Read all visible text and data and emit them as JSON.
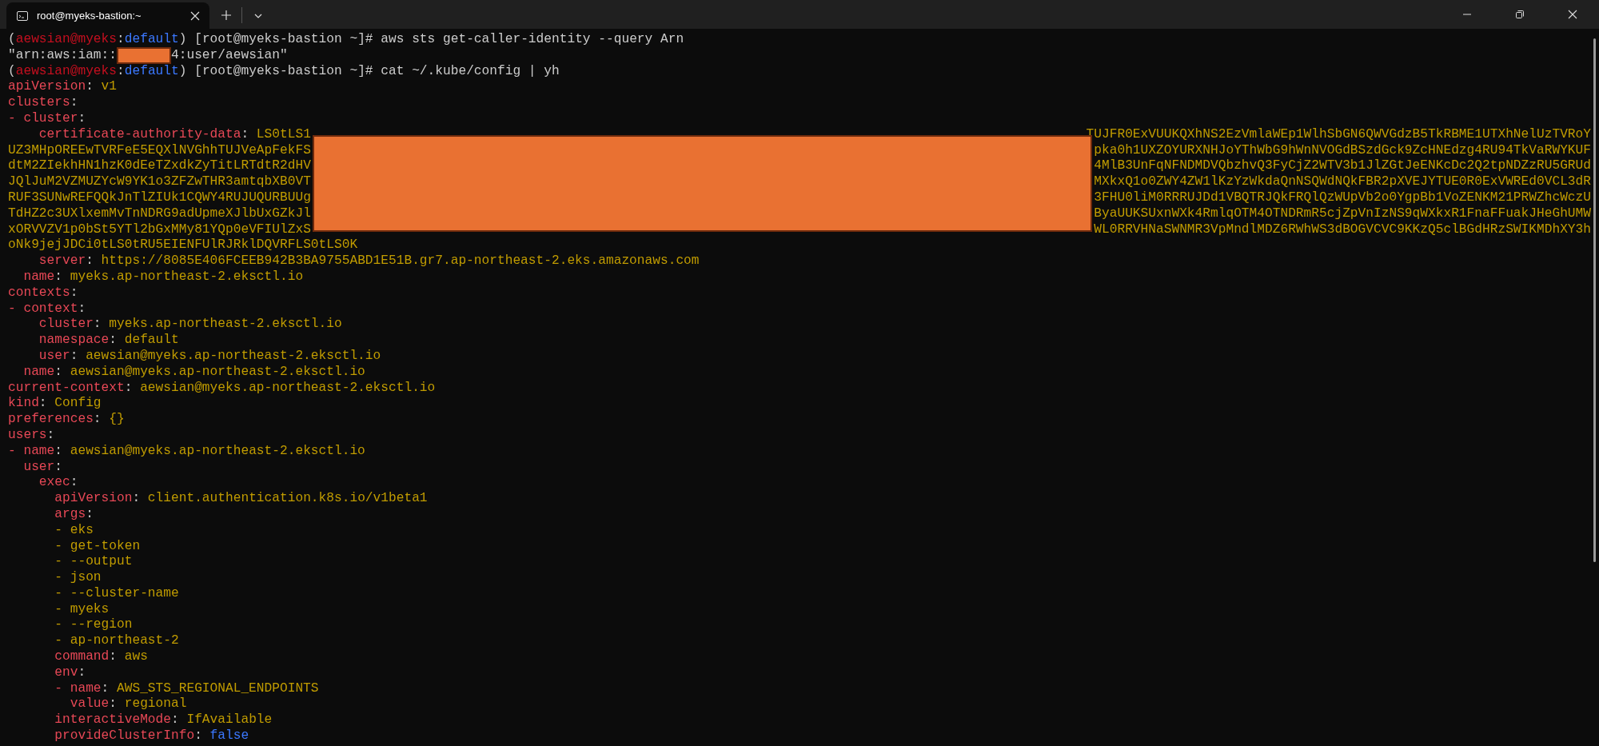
{
  "window": {
    "tab_title": "root@myeks-bastion:~"
  },
  "lines": [
    {
      "kind": "line",
      "segments": [
        {
          "kind": "plain",
          "text": "("
        },
        {
          "kind": "user",
          "text": "aewsian@myeks"
        },
        {
          "kind": "plain",
          "text": ":"
        },
        {
          "kind": "ns",
          "text": "default"
        },
        {
          "kind": "plain",
          "text": ") [root@myeks-bastion ~]# aws sts get-caller-identity --query Arn"
        }
      ]
    },
    {
      "kind": "line",
      "segments": [
        {
          "kind": "plain",
          "text": "\"arn:aws:iam::"
        },
        {
          "kind": "redacted"
        },
        {
          "kind": "plain",
          "text": "4:user/aewsian\""
        }
      ]
    },
    {
      "kind": "line",
      "segments": [
        {
          "kind": "plain",
          "text": "("
        },
        {
          "kind": "user",
          "text": "aewsian@myeks"
        },
        {
          "kind": "plain",
          "text": ":"
        },
        {
          "kind": "ns",
          "text": "default"
        },
        {
          "kind": "plain",
          "text": ") [root@myeks-bastion ~]# cat ~/.kube/config | yh"
        }
      ]
    },
    {
      "kind": "line",
      "segments": [
        {
          "kind": "key",
          "text": "apiVersion"
        },
        {
          "kind": "plain",
          "text": ":"
        },
        {
          "kind": "value",
          "text": "v1"
        }
      ]
    },
    {
      "kind": "line",
      "segments": [
        {
          "kind": "key",
          "text": "clusters"
        },
        {
          "kind": "plain",
          "text": ":"
        }
      ]
    },
    {
      "kind": "list_item",
      "dash": "-",
      "children": [
        {
          "kind": "line",
          "segments": [
            {
              "kind": "key",
              "text": "cluster"
            },
            {
              "kind": "plain",
              "text": ":"
            }
          ],
          "children": [
            {
              "kind": "wrapped",
              "segments": [
                {
                  "kind": "key",
                  "text": "certificate-authority-data"
                },
                {
                  "kind": "plain",
                  "text": ":"
                },
                {
                  "kind": "value",
                  "text": "LS0tLS1"
                }
              ],
              "right": "TUJFR0ExVUUKQXhNS2EzVmlaWEp1WlhSbGN6QWVGdzB5TkRBME1UTXhNelUzTVRoY",
              "continuation": [
                {
                  "kind": "value",
                  "text": "UZ3MHpOREEwTVRFeE5EQXlNVGhhTUJVeApFekFS",
                  "right": "pka0h1UXZOYURXNHJoYThWbG9hWnNVOGdBSzdGck9ZcHNEdzg4RU94TkVaRWYKUF"
                },
                {
                  "kind": "value",
                  "text": "dtM2ZIekhHN1hzK0dEeTZxdkZyTitLRTdtR2dHV",
                  "right": "4MlB3UnFqNFNDMDVQbzhvQ3FyCjZ2WTV3b1JlZGtJeENKcDc2Q2tpNDZzRU5GRUd"
                },
                {
                  "kind": "value",
                  "text": "JQlJuM2VZMUZYcW9YK1o3ZFZwTHR3amtqbXB0VT",
                  "right": "MXkxQ1o0ZWY4ZW1lKzYzWkdaQnNSQWdNQkFBR2pXVEJYTUE0R0ExVWREd0VCL3dR"
                },
                {
                  "kind": "value",
                  "text": "RUF3SUNwREFQQkJnTlZIUk1CQWY4RUJUQURBUUg",
                  "right": "3FHU0liM0RRRUJDd1VBQTRJQkFRQlQzWUpVb2o0YgpBb1VoZENKM21PRWZhcWczU"
                },
                {
                  "kind": "value",
                  "text": "TdHZ2c3UXlxemMvTnNDRG9adUpmeXJlbUxGZkJl",
                  "right": "ByaUUKSUxnWXk4RmlqOTM4OTNDRmR5cjZpVnIzNS9qWXkxR1FnaFFuakJHeGhUMW"
                },
                {
                  "kind": "value",
                  "text": "xORVVZV1p0bSt5YTl2bGxMMy81YQp0eVFIUlZxS",
                  "right": "WL0RRVHNaSWNMR3VpMndlMDZ6RWhWS3dBOGVCVC9KKzQ5clBGdHRzSWIKMDhXY3h"
                },
                {
                  "kind": "value",
                  "text": "oNk9jejJDCi0tLS0tRU5EIENFUlRJRklDQVRFLS0tLS0K"
                }
              ]
            },
            {
              "kind": "line",
              "segments": [
                {
                  "kind": "key",
                  "text": "server"
                },
                {
                  "kind": "plain",
                  "text": ":"
                },
                {
                  "kind": "value",
                  "text": "https://8085E406FCEEB942B3BA9755ABD1E51B.gr7.ap-northeast-2.eks.amazonaws.com"
                }
              ]
            }
          ]
        },
        {
          "kind": "line",
          "segments": [
            {
              "kind": "key",
              "text": "name"
            },
            {
              "kind": "plain",
              "text": ":"
            },
            {
              "kind": "value",
              "text": "myeks.ap-northeast-2.eksctl.io"
            }
          ]
        }
      ]
    },
    {
      "kind": "line",
      "segments": [
        {
          "kind": "key",
          "text": "contexts"
        },
        {
          "kind": "plain",
          "text": ":"
        }
      ]
    },
    {
      "kind": "list_item",
      "dash": "-",
      "children": [
        {
          "kind": "line",
          "segments": [
            {
              "kind": "key",
              "text": "context"
            },
            {
              "kind": "plain",
              "text": ":"
            }
          ],
          "children": [
            {
              "kind": "line",
              "segments": [
                {
                  "kind": "key",
                  "text": "cluster"
                },
                {
                  "kind": "plain",
                  "text": ":"
                },
                {
                  "kind": "value",
                  "text": "myeks.ap-northeast-2.eksctl.io"
                }
              ]
            },
            {
              "kind": "line",
              "segments": [
                {
                  "kind": "key",
                  "text": "namespace"
                },
                {
                  "kind": "plain",
                  "text": ":"
                },
                {
                  "kind": "value",
                  "text": "default"
                }
              ]
            },
            {
              "kind": "line",
              "segments": [
                {
                  "kind": "key",
                  "text": "user"
                },
                {
                  "kind": "plain",
                  "text": ":"
                },
                {
                  "kind": "value",
                  "text": "aewsian@myeks.ap-northeast-2.eksctl.io"
                }
              ]
            }
          ]
        },
        {
          "kind": "line",
          "segments": [
            {
              "kind": "key",
              "text": "name"
            },
            {
              "kind": "plain",
              "text": ":"
            },
            {
              "kind": "value",
              "text": "aewsian@myeks.ap-northeast-2.eksctl.io"
            }
          ]
        }
      ]
    },
    {
      "kind": "line",
      "segments": [
        {
          "kind": "key",
          "text": "current-context"
        },
        {
          "kind": "plain",
          "text": ":"
        },
        {
          "kind": "value",
          "text": "aewsian@myeks.ap-northeast-2.eksctl.io"
        }
      ]
    },
    {
      "kind": "line",
      "segments": [
        {
          "kind": "key",
          "text": "kind"
        },
        {
          "kind": "plain",
          "text": ":"
        },
        {
          "kind": "value",
          "text": "Config"
        }
      ]
    },
    {
      "kind": "line",
      "segments": [
        {
          "kind": "key",
          "text": "preferences"
        },
        {
          "kind": "plain",
          "text": ":"
        },
        {
          "kind": "value",
          "text": "{}"
        }
      ]
    },
    {
      "kind": "line",
      "segments": [
        {
          "kind": "key",
          "text": "users"
        },
        {
          "kind": "plain",
          "text": ":"
        }
      ]
    },
    {
      "kind": "list_item",
      "dash": "-",
      "children": [
        {
          "kind": "line",
          "segments": [
            {
              "kind": "key",
              "text": "name"
            },
            {
              "kind": "plain",
              "text": ":"
            },
            {
              "kind": "value",
              "text": "aewsian@myeks.ap-northeast-2.eksctl.io"
            }
          ]
        },
        {
          "kind": "line",
          "segments": [
            {
              "kind": "key",
              "text": "user"
            },
            {
              "kind": "plain",
              "text": ":"
            }
          ],
          "children": [
            {
              "kind": "line",
              "segments": [
                {
                  "kind": "key",
                  "text": "exec"
                },
                {
                  "kind": "plain",
                  "text": ":"
                }
              ],
              "children": [
                {
                  "kind": "line",
                  "segments": [
                    {
                      "kind": "key",
                      "text": "apiVersion"
                    },
                    {
                      "kind": "plain",
                      "text": ":"
                    },
                    {
                      "kind": "value",
                      "text": "client.authentication.k8s.io/v1beta1"
                    }
                  ]
                },
                {
                  "kind": "line",
                  "segments": [
                    {
                      "kind": "key",
                      "text": "args"
                    },
                    {
                      "kind": "plain",
                      "text": ":"
                    }
                  ]
                },
                {
                  "kind": "list_item",
                  "dash": "-",
                  "children": [
                    {
                      "kind": "line",
                      "segments": [
                        {
                          "kind": "value",
                          "text": "eks"
                        }
                      ]
                    }
                  ]
                },
                {
                  "kind": "list_item",
                  "dash": "-",
                  "children": [
                    {
                      "kind": "line",
                      "segments": [
                        {
                          "kind": "value",
                          "text": "get-token"
                        }
                      ]
                    }
                  ]
                },
                {
                  "kind": "list_item",
                  "dash": "-",
                  "children": [
                    {
                      "kind": "line",
                      "segments": [
                        {
                          "kind": "value",
                          "text": "--output"
                        }
                      ]
                    }
                  ]
                },
                {
                  "kind": "list_item",
                  "dash": "-",
                  "children": [
                    {
                      "kind": "line",
                      "segments": [
                        {
                          "kind": "value",
                          "text": "json"
                        }
                      ]
                    }
                  ]
                },
                {
                  "kind": "list_item",
                  "dash": "-",
                  "children": [
                    {
                      "kind": "line",
                      "segments": [
                        {
                          "kind": "value",
                          "text": "--cluster-name"
                        }
                      ]
                    }
                  ]
                },
                {
                  "kind": "list_item",
                  "dash": "-",
                  "children": [
                    {
                      "kind": "line",
                      "segments": [
                        {
                          "kind": "value",
                          "text": "myeks"
                        }
                      ]
                    }
                  ]
                },
                {
                  "kind": "list_item",
                  "dash": "-",
                  "children": [
                    {
                      "kind": "line",
                      "segments": [
                        {
                          "kind": "value",
                          "text": "--region"
                        }
                      ]
                    }
                  ]
                },
                {
                  "kind": "list_item",
                  "dash": "-",
                  "children": [
                    {
                      "kind": "line",
                      "segments": [
                        {
                          "kind": "value",
                          "text": "ap-northeast-2"
                        }
                      ]
                    }
                  ]
                },
                {
                  "kind": "line",
                  "segments": [
                    {
                      "kind": "key",
                      "text": "command"
                    },
                    {
                      "kind": "plain",
                      "text": ":"
                    },
                    {
                      "kind": "value",
                      "text": "aws"
                    }
                  ]
                },
                {
                  "kind": "line",
                  "segments": [
                    {
                      "kind": "key",
                      "text": "env"
                    },
                    {
                      "kind": "plain",
                      "text": ":"
                    }
                  ]
                },
                {
                  "kind": "list_item",
                  "dash": "-",
                  "children": [
                    {
                      "kind": "line",
                      "segments": [
                        {
                          "kind": "key",
                          "text": "name"
                        },
                        {
                          "kind": "plain",
                          "text": ":"
                        },
                        {
                          "kind": "value",
                          "text": "AWS_STS_REGIONAL_ENDPOINTS"
                        }
                      ]
                    },
                    {
                      "kind": "line",
                      "segments": [
                        {
                          "kind": "key",
                          "text": "value"
                        },
                        {
                          "kind": "plain",
                          "text": ":"
                        },
                        {
                          "kind": "value",
                          "text": "regional"
                        }
                      ]
                    }
                  ]
                },
                {
                  "kind": "line",
                  "segments": [
                    {
                      "kind": "key",
                      "text": "interactiveMode"
                    },
                    {
                      "kind": "plain",
                      "text": ":"
                    },
                    {
                      "kind": "value",
                      "text": "IfAvailable"
                    }
                  ]
                },
                {
                  "kind": "line",
                  "segments": [
                    {
                      "kind": "key",
                      "text": "provideClusterInfo"
                    },
                    {
                      "kind": "plain",
                      "text": ":"
                    },
                    {
                      "kind": "bool",
                      "text": "false"
                    }
                  ]
                }
              ]
            }
          ]
        }
      ]
    }
  ]
}
